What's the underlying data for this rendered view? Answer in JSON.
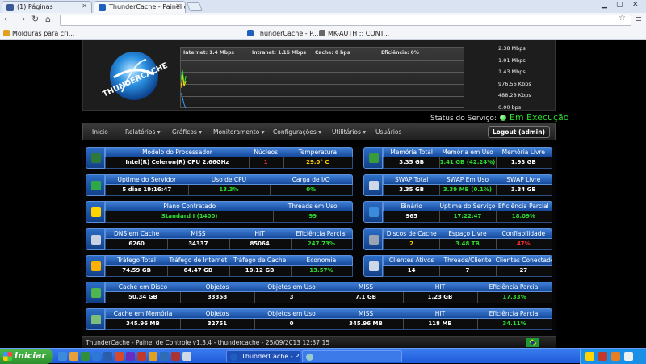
{
  "browser": {
    "tabs": [
      {
        "label": "(1) Páginas",
        "icon_color": "#3b5998"
      },
      {
        "label": "ThunderCache - Painel d",
        "icon_color": "#1f5fbf"
      }
    ],
    "bookmarks": [
      {
        "label": "Molduras para cri...",
        "icon_color": "#e0a020"
      },
      {
        "label": "ThunderCache - P...",
        "icon_color": "#1f5fbf"
      },
      {
        "label": "MK-AUTH :: CONT...",
        "icon_color": "#666666"
      }
    ]
  },
  "graph": {
    "legend": [
      {
        "label": "Internet: 1.4 Mbps",
        "color": "#ffd400"
      },
      {
        "label": "Intranet: 1.16 Mbps",
        "color": "#2ddc2d"
      },
      {
        "label": "Cache: 0 bps",
        "color": "#3aa0ff"
      },
      {
        "label": "Eficiência: 0%",
        "color": "#ffffff"
      }
    ],
    "scale": [
      "2.38 Mbps",
      "1.91 Mbps",
      "1.43 Mbps",
      "976.56 Kbps",
      "488.28 Kbps",
      "0.00 bps"
    ]
  },
  "status": {
    "label": "Status do Serviço:",
    "value": "Em Execução"
  },
  "menu": {
    "items": [
      "Início",
      "Relatórios ▾",
      "Gráficos ▾",
      "Monitoramento ▾",
      "Configurações ▾",
      "Utilitários ▾",
      "Usuários"
    ],
    "logout": "Logout (admin)"
  },
  "panels": [
    {
      "headers": [
        "Modelo do Processador",
        "Núcleos",
        "Temperatura"
      ],
      "values": [
        "Intel(R) Celeron(R) CPU 2.66GHz",
        "1",
        "29.0° C"
      ],
      "colors": [
        "",
        "r",
        "y"
      ],
      "icon": "cpu-icon"
    },
    {
      "headers": [
        "Memória Total",
        "Memória em Uso",
        "Memória Livre"
      ],
      "values": [
        "3.35 GB",
        "1.41 GB (42.24%)",
        "1.93 GB"
      ],
      "colors": [
        "",
        "g",
        ""
      ],
      "icon": "memory-icon"
    },
    {
      "headers": [
        "Uptime do Servidor",
        "Uso de CPU",
        "Carga de I/O"
      ],
      "values": [
        "5 dias 19:16:47",
        "13.3%",
        "0%"
      ],
      "colors": [
        "",
        "g",
        "g"
      ],
      "icon": "monitor-icon"
    },
    {
      "headers": [
        "SWAP Total",
        "SWAP Em Uso",
        "SWAP Livre"
      ],
      "values": [
        "3.35 GB",
        "3.39 MB (0.1%)",
        "3.34 GB"
      ],
      "colors": [
        "",
        "g",
        ""
      ],
      "icon": "swap-icon"
    },
    {
      "headers": [
        "Plano Contratado",
        "Threads em Uso"
      ],
      "values": [
        "Standard I (1400)",
        "99"
      ],
      "colors": [
        "g",
        "g"
      ],
      "icon": "plan-icon"
    },
    {
      "headers": [
        "Binário",
        "Uptime do Serviço",
        "Eficiência Parcial"
      ],
      "values": [
        "965",
        "17:22:47",
        "18.09%"
      ],
      "colors": [
        "",
        "g",
        "g"
      ],
      "icon": "globe-icon"
    },
    {
      "headers": [
        "DNS em Cache",
        "MISS",
        "HIT",
        "Eficiência Parcial"
      ],
      "values": [
        "6260",
        "34337",
        "85064",
        "247.73%"
      ],
      "colors": [
        "",
        "",
        "",
        "g"
      ],
      "icon": "dns-icon"
    },
    {
      "headers": [
        "Discos de Cache",
        "Espaço Livre",
        "Confiabilidade"
      ],
      "values": [
        "2",
        "3.48 TB",
        "47%"
      ],
      "colors": [
        "y",
        "g",
        "r"
      ],
      "icon": "disk-icon"
    },
    {
      "headers": [
        "Tráfego Total",
        "Tráfego de Internet",
        "Tráfego de Cache",
        "Economia"
      ],
      "values": [
        "74.59 GB",
        "64.47 GB",
        "10.12 GB",
        "13.57%"
      ],
      "colors": [
        "",
        "",
        "",
        "g"
      ],
      "icon": "traffic-icon"
    },
    {
      "headers": [
        "Clientes Ativos",
        "Threads/Cliente",
        "Clientes Conectados"
      ],
      "values": [
        "14",
        "7",
        "27"
      ],
      "colors": [
        "",
        "",
        ""
      ],
      "icon": "clients-icon"
    },
    {
      "headers": [
        "Cache em Disco",
        "Objetos",
        "Objetos em Uso",
        "MISS",
        "HIT",
        "Eficiência Parcial"
      ],
      "values": [
        "50.34 GB",
        "33358",
        "3",
        "7.1 GB",
        "1.23 GB",
        "17.33%"
      ],
      "colors": [
        "",
        "",
        "",
        "",
        "",
        "g"
      ],
      "icon": "disk-cache-icon"
    },
    {
      "headers": [
        "Cache em Memória",
        "Objetos",
        "Objetos em Uso",
        "MISS",
        "HIT",
        "Eficiência Parcial"
      ],
      "values": [
        "345.96 MB",
        "32751",
        "0",
        "345.96 MB",
        "118 MB",
        "34.11%"
      ],
      "colors": [
        "",
        "",
        "",
        "",
        "",
        "g"
      ],
      "icon": "memory-cache-icon"
    }
  ],
  "footer": {
    "text": "ThunderCache - Painel de Controle v1.3.4 - thundercache - 25/09/2013 12:37:15"
  },
  "taskbar": {
    "start": "Iniciar",
    "tasks": [
      {
        "label": "ThunderCache - P...",
        "icon_color": "#1f5fbf"
      }
    ]
  }
}
